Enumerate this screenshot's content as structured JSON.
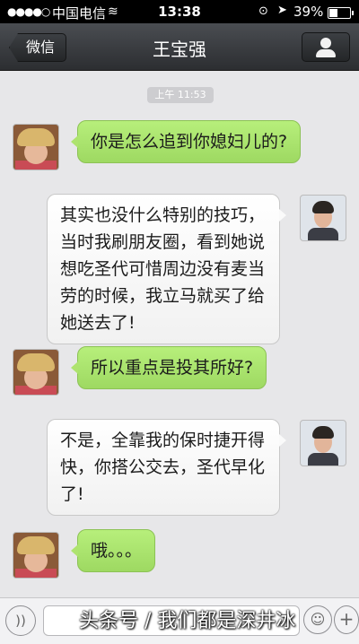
{
  "status_bar": {
    "signal": "●●●●○",
    "carrier": "中国电信",
    "time": "13:38",
    "battery": "39%",
    "battery_level": 0.39
  },
  "nav": {
    "back_label": "微信",
    "title": "王宝强"
  },
  "chat": {
    "timestamp": "上午 11:53",
    "messages": [
      {
        "side": "left",
        "text": "你是怎么追到你媳妇儿的?"
      },
      {
        "side": "right",
        "lines": [
          "其实也没什么特别的技巧，",
          "当时我刷朋友圈，看到她说",
          "想吃圣代可惜周边没有麦当",
          "劳的时候，我立马就买了给",
          "她送去了!"
        ]
      },
      {
        "side": "left",
        "text": "所以重点是投其所好?"
      },
      {
        "side": "right",
        "lines": [
          "不是，全靠我的保时捷开得",
          "快，你搭公交去，圣代早化",
          "了!"
        ]
      },
      {
        "side": "left",
        "text": "哦。。。"
      }
    ]
  },
  "watermark": "头条号 / 我们都是深井冰",
  "icons": {
    "voice": "voice-icon",
    "emoji": "emoji-icon",
    "plus": "plus-icon",
    "profile": "person-icon"
  }
}
